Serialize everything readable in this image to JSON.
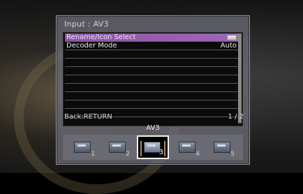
{
  "panel": {
    "title": "Input : AV3"
  },
  "menu": {
    "items": [
      {
        "label": "Rename/Icon Select",
        "value": "",
        "selected": true
      },
      {
        "label": "Decoder Mode",
        "value": "Auto",
        "selected": false
      }
    ]
  },
  "footer": {
    "back_label": "Back:RETURN",
    "page_indicator": "1 / 2"
  },
  "input_selector": {
    "current": "AV3",
    "slots": [
      {
        "number": "1"
      },
      {
        "number": "2"
      },
      {
        "number": "3",
        "active": true
      },
      {
        "number": "4"
      },
      {
        "number": "5"
      }
    ]
  },
  "colors": {
    "selection": "#9c67b3",
    "panel_bg": "#6e6e78",
    "list_bg": "#0b0b0b"
  }
}
